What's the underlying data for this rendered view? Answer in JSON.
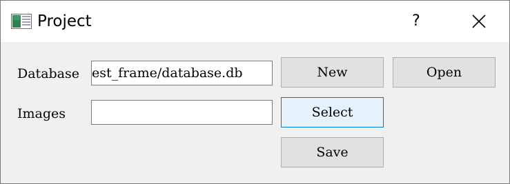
{
  "window": {
    "title": "Project",
    "help_label": "?",
    "icons": {
      "app": "app-project-icon",
      "close": "close-icon"
    }
  },
  "form": {
    "database_label": "Database",
    "database_value": "est_frame/database.db",
    "images_label": "Images",
    "images_value": ""
  },
  "buttons": {
    "new_label": "New",
    "open_label": "Open",
    "select_label": "Select",
    "save_label": "Save"
  },
  "colors": {
    "focus_border": "#0078d7",
    "focus_fill": "#e5f1fb"
  }
}
